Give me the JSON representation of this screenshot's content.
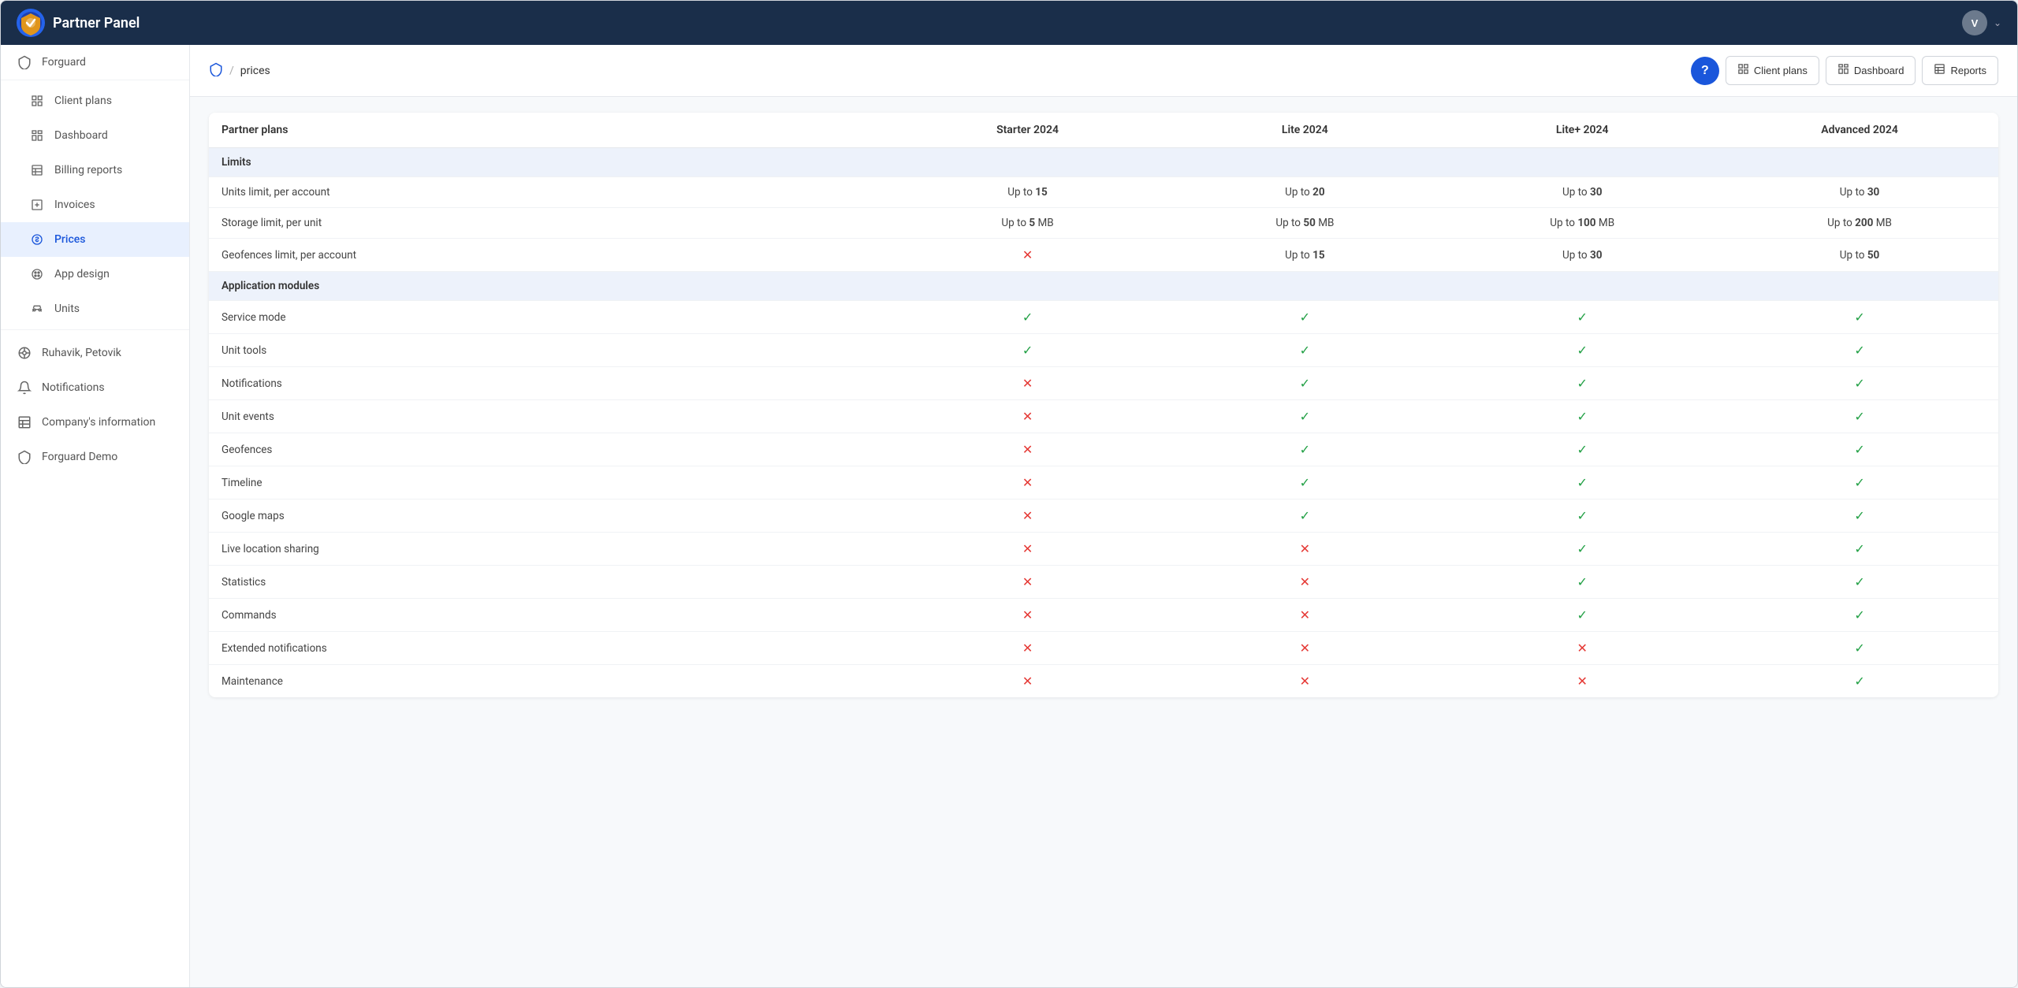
{
  "app": {
    "title": "Partner Panel",
    "avatar_initial": "V"
  },
  "sidebar": {
    "top_item": {
      "label": "Forguard",
      "icon": "shield"
    },
    "items": [
      {
        "id": "client-plans",
        "label": "Client plans",
        "icon": "grid-2x2",
        "active": false
      },
      {
        "id": "dashboard",
        "label": "Dashboard",
        "icon": "dashboard",
        "active": false
      },
      {
        "id": "billing-reports",
        "label": "Billing reports",
        "icon": "list",
        "active": false
      },
      {
        "id": "invoices",
        "label": "Invoices",
        "icon": "dollar-sq",
        "active": false
      },
      {
        "id": "prices",
        "label": "Prices",
        "icon": "dollar-circle",
        "active": true
      },
      {
        "id": "app-design",
        "label": "App design",
        "icon": "palette",
        "active": false
      },
      {
        "id": "units",
        "label": "Units",
        "icon": "car",
        "active": false
      }
    ],
    "bottom_items": [
      {
        "id": "ruhavik",
        "label": "Ruhavik, Petovik",
        "icon": "wheel",
        "active": false
      },
      {
        "id": "notifications",
        "label": "Notifications",
        "icon": "bell",
        "active": false
      },
      {
        "id": "company-info",
        "label": "Company's information",
        "icon": "table",
        "active": false
      },
      {
        "id": "forguard-demo",
        "label": "Forguard Demo",
        "icon": "shield2",
        "active": false
      }
    ]
  },
  "breadcrumb": {
    "root_icon": "shield",
    "separator": "/",
    "current": "prices"
  },
  "header_buttons": {
    "help_label": "?",
    "client_plans": "Client plans",
    "dashboard": "Dashboard",
    "reports": "Reports"
  },
  "table": {
    "col_feature": "Partner plans",
    "plans": [
      "Starter 2024",
      "Lite 2024",
      "Lite+ 2024",
      "Advanced 2024"
    ],
    "sections": [
      {
        "section_title": "Limits",
        "rows": [
          {
            "feature": "Units limit, per account",
            "values": [
              "Up to {15}",
              "Up to {20}",
              "Up to {30}",
              "Up to {30}"
            ],
            "bold_parts": [
              "15",
              "20",
              "30",
              "30"
            ]
          },
          {
            "feature": "Storage limit, per unit",
            "values": [
              "Up to {5} MB",
              "Up to {50} MB",
              "Up to {100} MB",
              "Up to {200} MB"
            ],
            "bold_parts": [
              "5",
              "50",
              "100",
              "200"
            ]
          },
          {
            "feature": "Geofences limit, per account",
            "values": [
              "cross",
              "Up to {15}",
              "Up to {30}",
              "Up to {50}"
            ],
            "bold_parts": [
              "",
              "15",
              "30",
              "50"
            ]
          }
        ]
      },
      {
        "section_title": "Application modules",
        "rows": [
          {
            "feature": "Service mode",
            "values": [
              "check",
              "check",
              "check",
              "check"
            ]
          },
          {
            "feature": "Unit tools",
            "values": [
              "check",
              "check",
              "check",
              "check"
            ]
          },
          {
            "feature": "Notifications",
            "values": [
              "cross",
              "check",
              "check",
              "check"
            ]
          },
          {
            "feature": "Unit events",
            "values": [
              "cross",
              "check",
              "check",
              "check"
            ]
          },
          {
            "feature": "Geofences",
            "values": [
              "cross",
              "check",
              "check",
              "check"
            ]
          },
          {
            "feature": "Timeline",
            "values": [
              "cross",
              "check",
              "check",
              "check"
            ]
          },
          {
            "feature": "Google maps",
            "values": [
              "cross",
              "check",
              "check",
              "check"
            ]
          },
          {
            "feature": "Live location sharing",
            "values": [
              "cross",
              "cross",
              "check",
              "check"
            ]
          },
          {
            "feature": "Statistics",
            "values": [
              "cross",
              "cross",
              "check",
              "check"
            ]
          },
          {
            "feature": "Commands",
            "values": [
              "cross",
              "cross",
              "check",
              "check"
            ]
          },
          {
            "feature": "Extended notifications",
            "values": [
              "cross",
              "cross",
              "cross",
              "check"
            ]
          },
          {
            "feature": "Maintenance",
            "values": [
              "cross",
              "cross",
              "cross",
              "check"
            ]
          }
        ]
      }
    ]
  }
}
